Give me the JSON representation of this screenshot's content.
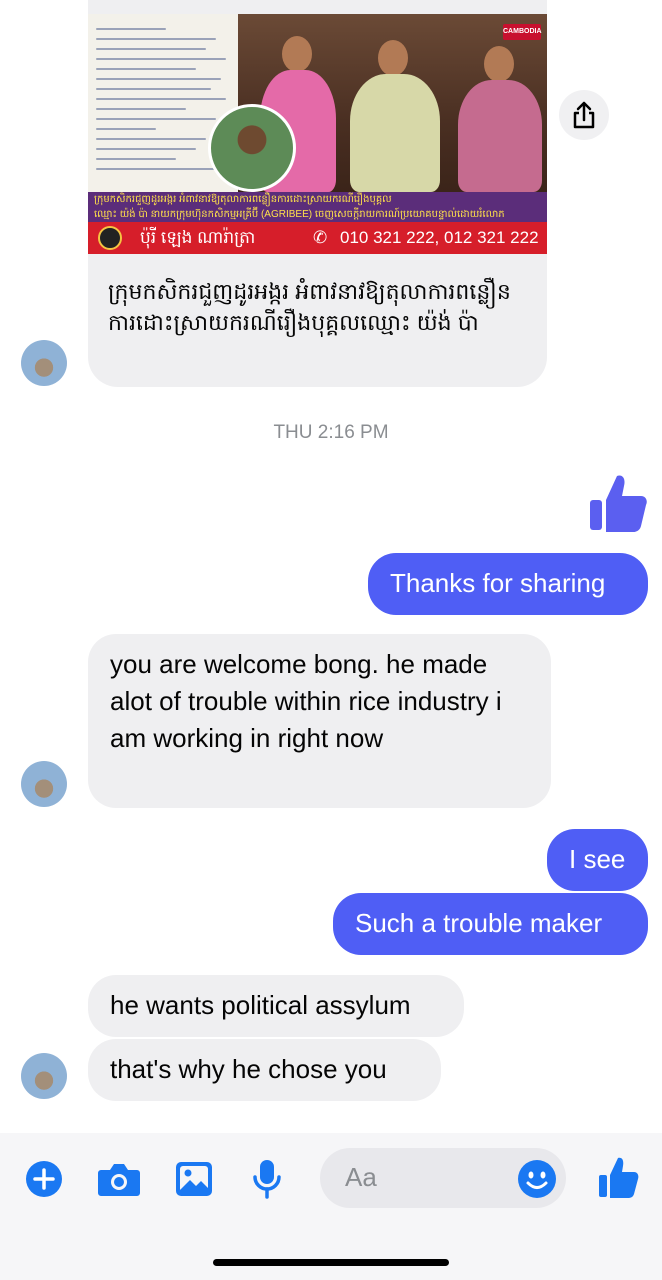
{
  "link_card": {
    "image_caption_line1": "ក្រុមកសិករជួញដូរអង្ករ អំពាវនាវឱ្យតុលាការពន្លឿនការដោះស្រាយករណីរឿងបុគ្គល",
    "image_caption_line2": "ឈ្មោះ យ៉ង់ ប៉ា នាយកក្រុមហ៊ុនកសិកម្មអគ្រីប៊ី (AGRIBEE) ចេញសេចក្តីរាយការណ៍ប្រយោគបន្ទាល់ដោយរំលោភ",
    "badge": "CAMBODIA",
    "publisher": "ប៉ុរី ឡេង ណារ៉ាត្រា",
    "phone": "010 321 222, 012 321 222",
    "title": "ក្រុមកសិករជួញដូរអង្ករ អំពាវនាវឱ្យតុលាការពន្លឿនការដោះស្រាយករណីរឿងបុគ្គលឈ្មោះ យ៉ង់ ប៉ា"
  },
  "timestamp": "THU 2:16 PM",
  "messages": {
    "m1": "Thanks for sharing",
    "m2": "you are welcome bong. he made alot of trouble within rice industry i am working in right now",
    "m3": "I see",
    "m4": "Such a trouble maker",
    "m5": "he wants political assylum",
    "m6": "that's why he chose you"
  },
  "composer": {
    "placeholder": "Aa"
  },
  "colors": {
    "outgoing": "#4f5ef5",
    "incoming": "#efeff1",
    "accent": "#1a78f2"
  },
  "icons": [
    "share-icon",
    "thumbs-up-icon",
    "plus-icon",
    "camera-icon",
    "image-icon",
    "microphone-icon",
    "emoji-icon"
  ]
}
